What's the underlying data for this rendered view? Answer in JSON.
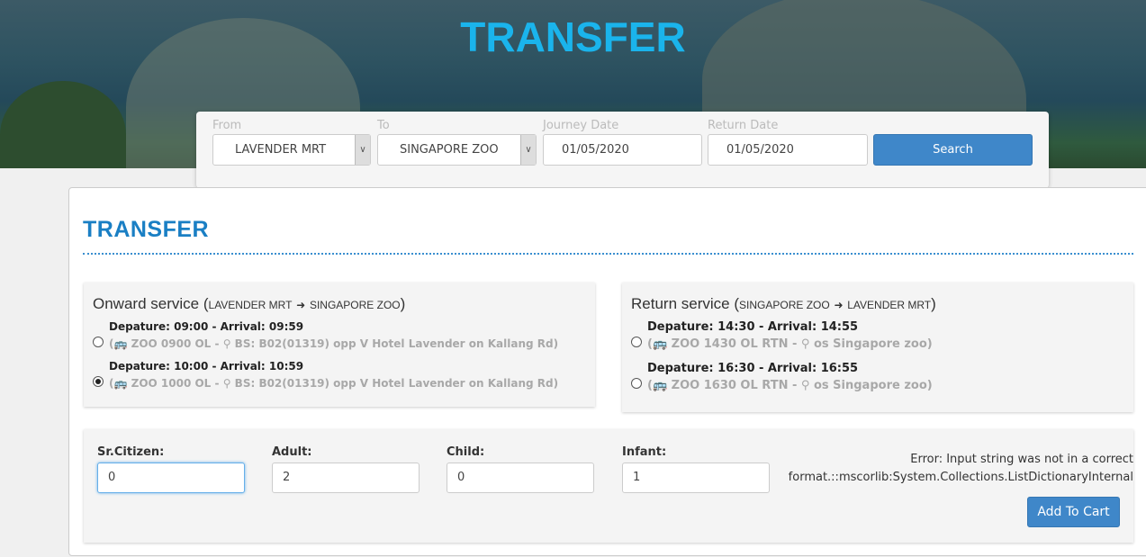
{
  "banner": {
    "title": "TRANSFER"
  },
  "search": {
    "from_label": "From",
    "from_value": "LAVENDER MRT",
    "to_label": "To",
    "to_value": "SINGAPORE ZOO",
    "journey_label": "Journey Date",
    "journey_value": "01/05/2020",
    "return_label": "Return Date",
    "return_value": "01/05/2020",
    "search_button": "Search"
  },
  "main": {
    "title": "TRANSFER"
  },
  "onward": {
    "title": "Onward service",
    "route_open": "(",
    "route_from": "LAVENDER MRT",
    "route_to": "SINGAPORE ZOO",
    "route_close": ")",
    "options": [
      {
        "times": "Depature: 09:00 - Arrival: 09:59",
        "service": "ZOO 0900 OL",
        "stop": "BS: B02(01319) opp V Hotel Lavender on Kallang Rd",
        "selected": false
      },
      {
        "times": "Depature: 10:00 - Arrival: 10:59",
        "service": "ZOO 1000 OL",
        "stop": "BS: B02(01319) opp V Hotel Lavender on Kallang Rd",
        "selected": true
      }
    ]
  },
  "return": {
    "title": "Return service",
    "route_open": "(",
    "route_from": "SINGAPORE ZOO",
    "route_to": "LAVENDER MRT",
    "route_close": ")",
    "options": [
      {
        "times": "Depature: 14:30 - Arrival: 14:55",
        "service": "ZOO 1430 OL RTN",
        "stop": "os Singapore zoo",
        "selected": false
      },
      {
        "times": "Depature: 16:30 - Arrival: 16:55",
        "service": "ZOO 1630 OL RTN",
        "stop": "os Singapore zoo",
        "selected": false
      }
    ]
  },
  "passengers": {
    "sr_label": "Sr.Citizen:",
    "sr_value": "0",
    "adult_label": "Adult:",
    "adult_value": "2",
    "child_label": "Child:",
    "child_value": "0",
    "infant_label": "Infant:",
    "infant_value": "1",
    "error_line1": "Error: Input string was not in a correct",
    "error_line2": "format.::mscorlib:System.Collections.ListDictionaryInternal",
    "add_to_cart": "Add To Cart"
  },
  "colors": {
    "accent": "#1ab4ec",
    "title": "#1a7fc4",
    "button": "#3f87c9"
  }
}
